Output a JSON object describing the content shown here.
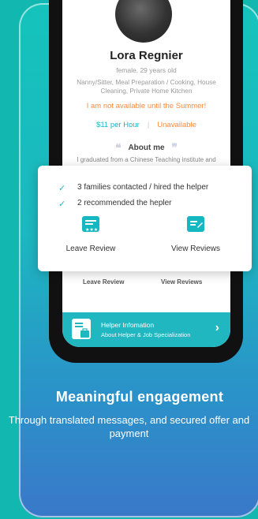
{
  "profile": {
    "name": "Lora Regnier",
    "meta": "female, 29 years old",
    "services": "Nanny/Sitter, Meal Preparation / Cooking, House Cleaning, Private Home Kitchen",
    "availability": "I am not available until the Summer!",
    "price": "$11 per Hour",
    "status": "Unavailable",
    "about_title": "About me",
    "about_text": "I graduated from a Chinese Teaching institute and"
  },
  "popup": {
    "items": [
      "3 families contacted / hired the helper",
      "2 recommended the hepler"
    ],
    "leave_review": "Leave Review",
    "view_reviews": "View Reviews"
  },
  "behind": {
    "leave_review": "Leave Review",
    "view_reviews": "View Reviews"
  },
  "helper_bar": {
    "title": "Helper Infomation",
    "subtitle": "About Helper & Job Specialization"
  },
  "marketing": {
    "headline": "Meaningful engagement",
    "subline": "Through translated messages, and secured offer and payment"
  },
  "colors": {
    "accent": "#15b6c4",
    "warning": "#ff8a3d",
    "background": "#12b8b0"
  }
}
